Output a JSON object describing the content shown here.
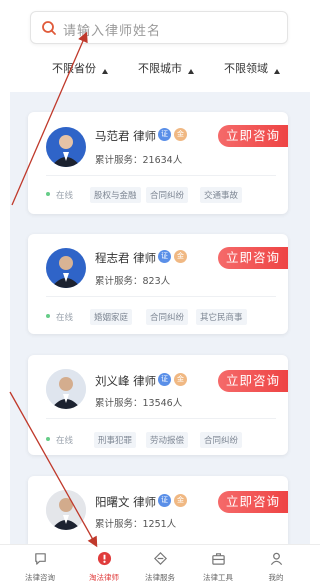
{
  "search": {
    "placeholder": "请输入律师姓名"
  },
  "filters": [
    "不限省份",
    "不限城市",
    "不限领域"
  ],
  "consult_label": "立即咨询",
  "online_label": "在线",
  "verify_badge": "证",
  "gold_badge": "金",
  "lawyers": [
    {
      "name": "马范君 律师",
      "served": "累计服务：21634人",
      "tags": [
        "股权与金融",
        "合同纠纷",
        "交通事故"
      ]
    },
    {
      "name": "程志君 律师",
      "served": "累计服务：823人",
      "tags": [
        "婚姻家庭",
        "合同纠纷",
        "其它民商事"
      ]
    },
    {
      "name": "刘义峰 律师",
      "served": "累计服务：13546人",
      "tags": [
        "刑事犯罪",
        "劳动报偿",
        "合同纠纷"
      ]
    },
    {
      "name": "阳曙文 律师",
      "served": "累计服务：1251人",
      "tags": []
    }
  ],
  "tabs": [
    {
      "label": "法律咨询",
      "icon": "chat-icon"
    },
    {
      "label": "淘法律师",
      "icon": "lawyer-icon"
    },
    {
      "label": "法律服务",
      "icon": "service-icon"
    },
    {
      "label": "法律工具",
      "icon": "toolbox-icon"
    },
    {
      "label": "我的",
      "icon": "profile-icon"
    }
  ],
  "colors": {
    "accent": "#ee4444",
    "verify": "#5a8fe8",
    "gold": "#f0b883",
    "list_bg": "#eef2f8"
  }
}
